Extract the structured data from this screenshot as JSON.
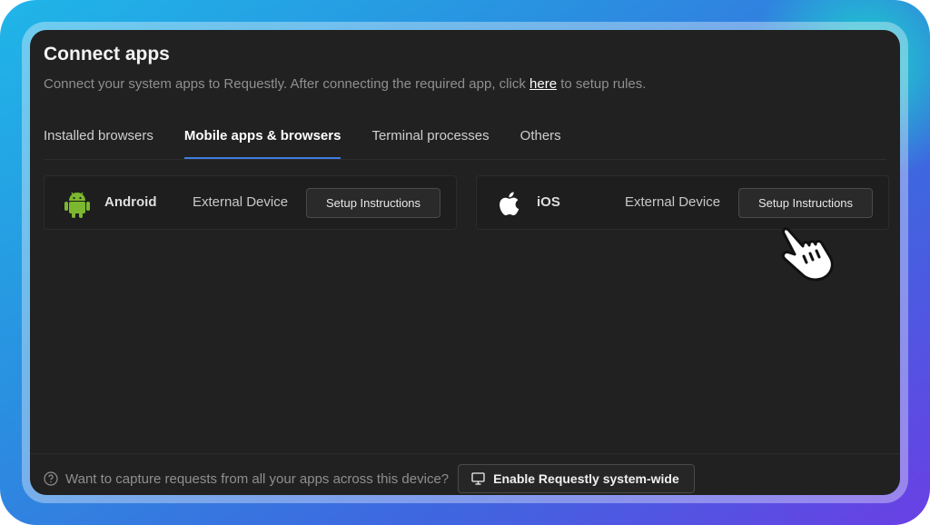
{
  "header": {
    "title": "Connect apps",
    "subtitle_prefix": "Connect your system apps to Requestly. After connecting the required app, click ",
    "subtitle_link": "here",
    "subtitle_suffix": " to setup rules."
  },
  "tabs": [
    {
      "label": "Installed browsers",
      "active": false
    },
    {
      "label": "Mobile apps & browsers",
      "active": true
    },
    {
      "label": "Terminal processes",
      "active": false
    },
    {
      "label": "Others",
      "active": false
    }
  ],
  "apps": [
    {
      "name": "Android",
      "kind": "External Device",
      "button": "Setup Instructions",
      "icon": "android-icon",
      "icon_color": "#7cb82f"
    },
    {
      "name": "iOS",
      "kind": "External Device",
      "button": "Setup Instructions",
      "icon": "apple-icon",
      "icon_color": "#ffffff"
    }
  ],
  "footer": {
    "text": "Want to capture requests from all your apps across this device?",
    "button": "Enable Requestly system-wide"
  },
  "colors": {
    "accent": "#3d7ce0",
    "window_bg": "#212121"
  }
}
